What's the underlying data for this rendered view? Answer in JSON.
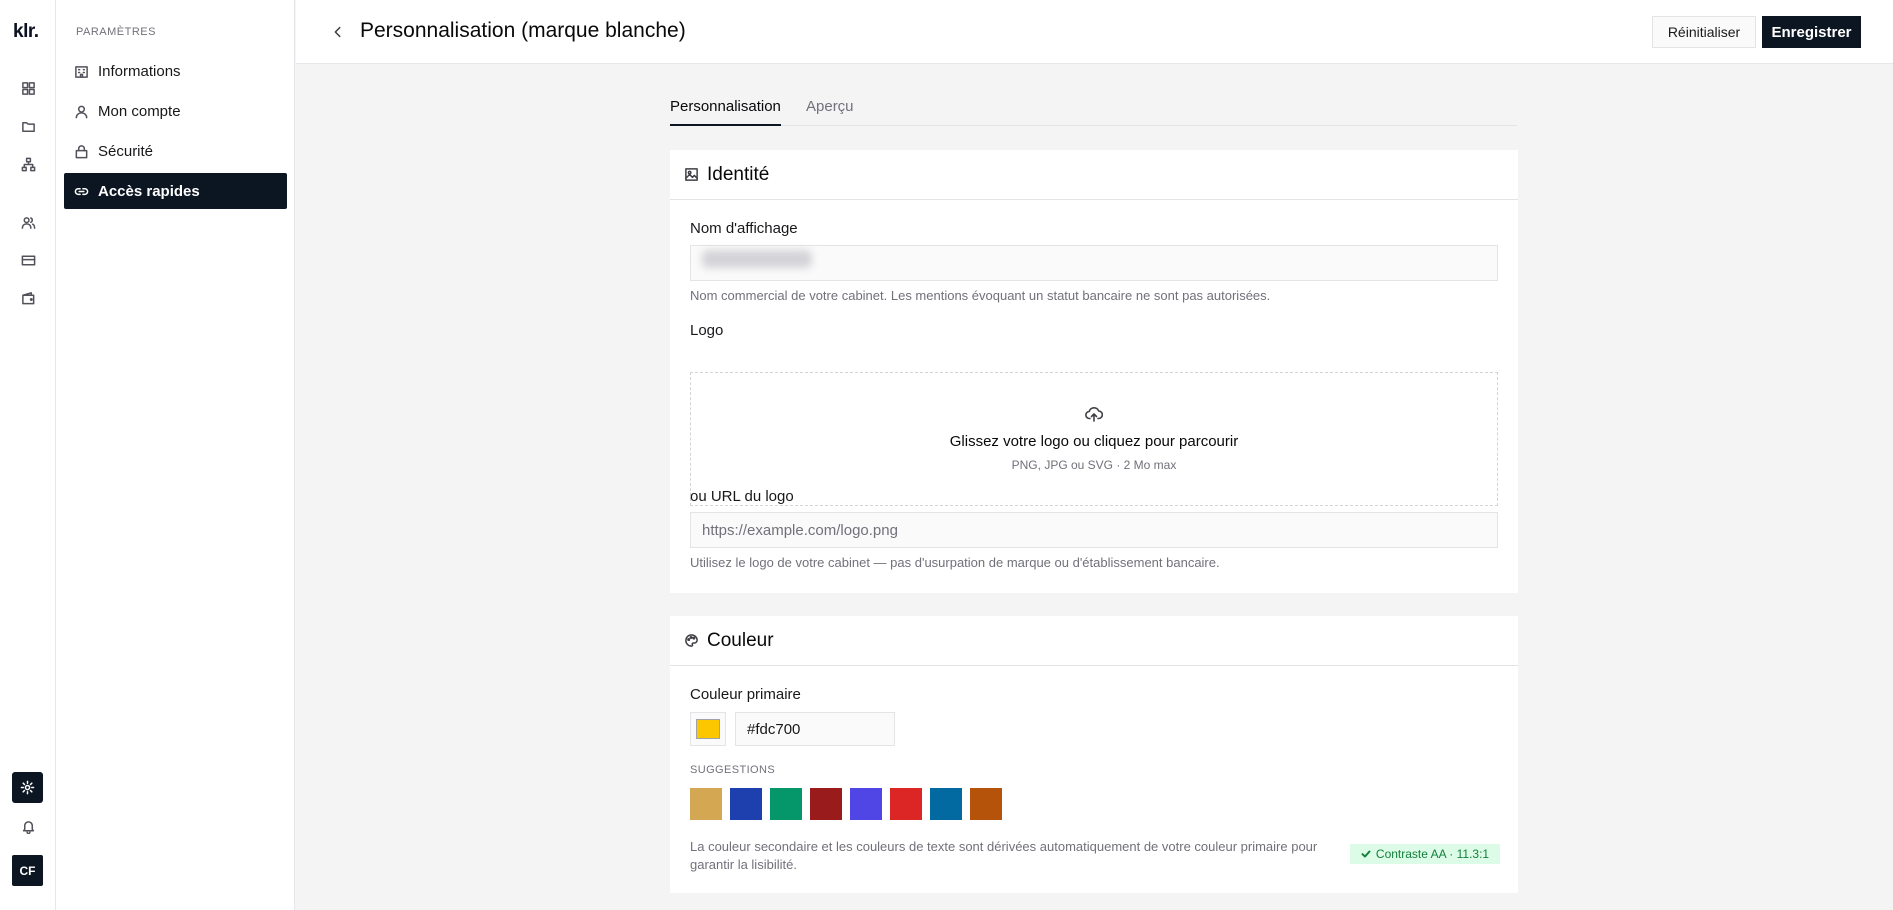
{
  "app": {
    "logo": "klr."
  },
  "rail": {
    "icons": [
      "dashboard-icon",
      "folder-icon",
      "org-chart-icon",
      "users-icon",
      "card-icon",
      "wallet-icon"
    ],
    "settings_icon": "gear-icon",
    "bell_icon": "bell-icon",
    "avatar_initials": "CF"
  },
  "sidebar": {
    "section_title": "PARAMÈTRES",
    "items": [
      {
        "label": "Informations",
        "icon": "building-icon",
        "active": false
      },
      {
        "label": "Mon compte",
        "icon": "user-icon",
        "active": false
      },
      {
        "label": "Sécurité",
        "icon": "lock-icon",
        "active": false
      },
      {
        "label": "Accès rapides",
        "icon": "link-icon",
        "active": true
      }
    ]
  },
  "header": {
    "title": "Personnalisation (marque blanche)",
    "reset_label": "Réinitialiser",
    "save_label": "Enregistrer"
  },
  "tabs": [
    {
      "label": "Personnalisation",
      "active": true
    },
    {
      "label": "Aperçu",
      "active": false
    }
  ],
  "identity": {
    "title": "Identité",
    "display_name_label": "Nom d'affichage",
    "display_name_value": "",
    "display_name_help": "Nom commercial de votre cabinet. Les mentions évoquant un statut bancaire ne sont pas autorisées.",
    "logo_label": "Logo",
    "dropzone_main": "Glissez votre logo ou cliquez pour parcourir",
    "dropzone_sub": "PNG, JPG ou SVG · 2 Mo max",
    "logo_url_label": "ou URL du logo",
    "logo_url_placeholder": "https://example.com/logo.png",
    "logo_url_help": "Utilisez le logo de votre cabinet — pas d'usurpation de marque ou d'établissement bancaire."
  },
  "color": {
    "title": "Couleur",
    "primary_label": "Couleur primaire",
    "primary_value": "#fdc700",
    "suggestions_label": "SUGGESTIONS",
    "suggestions": [
      "#d4a853",
      "#1e40af",
      "#059669",
      "#991b1b",
      "#4f46e5",
      "#dc2626",
      "#0369a1",
      "#b45309"
    ],
    "help": "La couleur secondaire et les couleurs de texte sont dérivées automatiquement de votre couleur primaire pour garantir la lisibilité.",
    "contrast_badge": "Contraste AA · 11.3:1"
  }
}
